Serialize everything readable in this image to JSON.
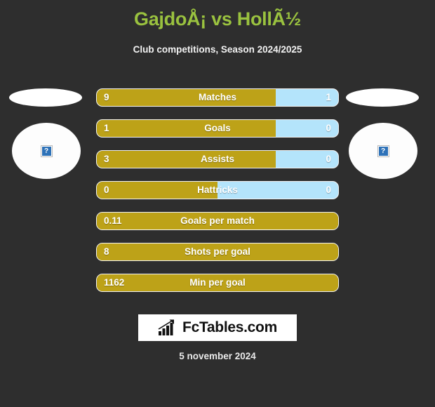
{
  "header": {
    "title": "GajdoÅ¡ vs HollÃ½",
    "subtitle": "Club competitions, Season 2024/2025"
  },
  "players": {
    "home": {
      "photo_placeholder_icon": "broken-image-icon",
      "placeholder_glyph": "?"
    },
    "away": {
      "photo_placeholder_icon": "broken-image-icon",
      "placeholder_glyph": "?"
    }
  },
  "colors": {
    "background": "#2e2e2e",
    "title": "#9ac23f",
    "home_bar": "#bda218",
    "away_bar": "#b4e4fb",
    "bar_border": "#f3f3f3",
    "text": "#ffffff",
    "logo_bg": "#ffffff",
    "logo_text": "#111111",
    "placeholder_blue": "#2e72b8"
  },
  "stats": [
    {
      "label": "Matches",
      "home": "9",
      "away": "1",
      "home_pct": 74,
      "has_away": true
    },
    {
      "label": "Goals",
      "home": "1",
      "away": "0",
      "home_pct": 74,
      "has_away": true
    },
    {
      "label": "Assists",
      "home": "3",
      "away": "0",
      "home_pct": 74,
      "has_away": true
    },
    {
      "label": "Hattricks",
      "home": "0",
      "away": "0",
      "home_pct": 50,
      "has_away": true
    },
    {
      "label": "Goals per match",
      "home": "0.11",
      "away": "",
      "home_pct": 100,
      "has_away": false
    },
    {
      "label": "Shots per goal",
      "home": "8",
      "away": "",
      "home_pct": 100,
      "has_away": false
    },
    {
      "label": "Min per goal",
      "home": "1162",
      "away": "",
      "home_pct": 100,
      "has_away": false
    }
  ],
  "footer": {
    "logo_icon": "bar-chart-arrow-icon",
    "logo_text": "FcTables.com",
    "date": "5 november 2024"
  },
  "chart_data": {
    "type": "bar",
    "title": "GajdoÅ¡ vs HollÃ½",
    "subtitle": "Club competitions, Season 2024/2025",
    "categories": [
      "Matches",
      "Goals",
      "Assists",
      "Hattricks",
      "Goals per match",
      "Shots per goal",
      "Min per goal"
    ],
    "series": [
      {
        "name": "GajdoÅ¡",
        "values": [
          9,
          1,
          3,
          0,
          0.11,
          8,
          1162
        ]
      },
      {
        "name": "HollÃ½",
        "values": [
          1,
          0,
          0,
          0,
          null,
          null,
          null
        ]
      }
    ],
    "grid": false,
    "legend": "none",
    "xlabel": "",
    "ylabel": ""
  }
}
